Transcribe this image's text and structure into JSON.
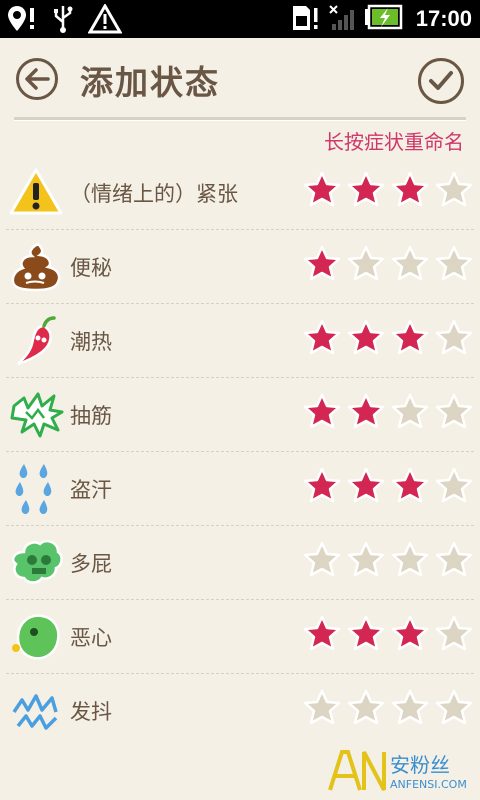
{
  "statusbar": {
    "time": "17:00"
  },
  "header": {
    "title": "添加状态"
  },
  "hint": "长按症状重命名",
  "colors": {
    "star_on": "#d32653",
    "star_off": "#ddd5c4",
    "text": "#6a5644",
    "accent": "#d0386a"
  },
  "symptoms": [
    {
      "label": "（情绪上的）紧张",
      "icon": "warning-icon",
      "rating": 3,
      "max": 4
    },
    {
      "label": "便秘",
      "icon": "poop-icon",
      "rating": 1,
      "max": 4
    },
    {
      "label": "潮热",
      "icon": "chili-pepper-icon",
      "rating": 3,
      "max": 4
    },
    {
      "label": "抽筋",
      "icon": "cramp-zigzag-icon",
      "rating": 2,
      "max": 4
    },
    {
      "label": "盗汗",
      "icon": "sweat-drops-icon",
      "rating": 3,
      "max": 4
    },
    {
      "label": "多屁",
      "icon": "gas-cloud-icon",
      "rating": 0,
      "max": 4
    },
    {
      "label": "恶心",
      "icon": "nausea-face-icon",
      "rating": 3,
      "max": 4
    },
    {
      "label": "发抖",
      "icon": "shiver-zigzag-icon",
      "rating": 0,
      "max": 4
    }
  ],
  "watermark": {
    "main": "AN安粉丝",
    "sub": "ANFENSI.COM"
  }
}
